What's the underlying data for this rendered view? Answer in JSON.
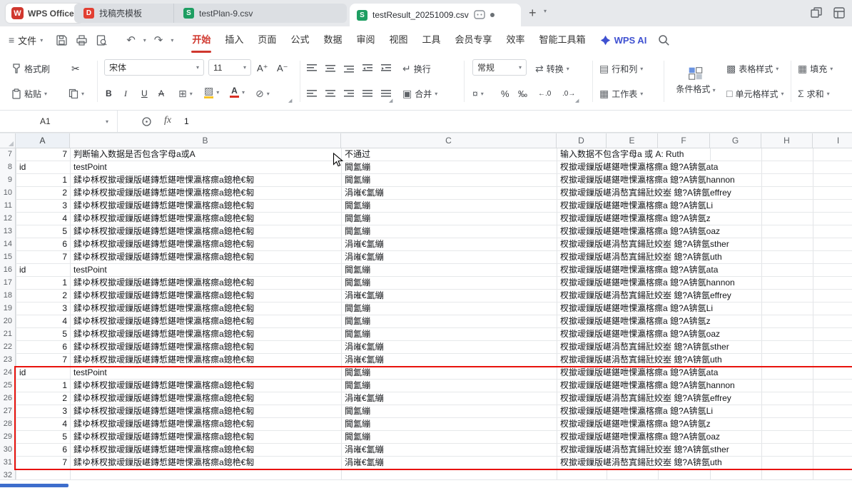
{
  "tab_bar": {
    "app_button": "WPS Office",
    "tabs": [
      {
        "label": "找稿壳模板",
        "type": "docer"
      },
      {
        "label": "testPlan-9.csv",
        "type": "sheet"
      },
      {
        "label": "testResult_20251009.csv",
        "type": "sheet",
        "active": true
      }
    ],
    "unsaved_dot": "●",
    "new_tab": "+"
  },
  "menu_bar": {
    "file_label": "文件",
    "menus": [
      {
        "label": "开始",
        "active": true
      },
      {
        "label": "插入"
      },
      {
        "label": "页面"
      },
      {
        "label": "公式"
      },
      {
        "label": "数据"
      },
      {
        "label": "审阅"
      },
      {
        "label": "视图"
      },
      {
        "label": "工具"
      },
      {
        "label": "会员专享"
      },
      {
        "label": "效率"
      },
      {
        "label": "智能工具箱"
      }
    ],
    "wps_ai": "WPS AI"
  },
  "toolbar": {
    "format_painter": "格式刷",
    "paste": "粘贴",
    "font_name": "宋体",
    "font_size": "11",
    "wrap": "换行",
    "merge": "合并",
    "number_format": "常规",
    "convert": "转换",
    "rows_cols": "行和列",
    "worksheet": "工作表",
    "conditional_format": "条件格式",
    "table_style": "表格样式",
    "cell_style": "单元格样式",
    "fill": "填充",
    "sum": "求和"
  },
  "formula_bar": {
    "name_box": "A1",
    "fx_label": "fx",
    "value": "1"
  },
  "icons": {
    "caret": "▾",
    "menu": "≡",
    "plus": "+",
    "scissors": "✂",
    "undo": "↶",
    "redo": "↷",
    "bold": "B",
    "italic": "I",
    "underline": "U",
    "strike": "A",
    "borders": "⊞",
    "fill_color": "▨",
    "font_color": "A",
    "clear": "⊘",
    "wrap": "↵",
    "merge": "▣",
    "convert": "⇄",
    "currency": "¤",
    "percent": "%",
    "permille": "‰",
    "dec_inc": "←.0",
    "dec_dec": ".0→",
    "rows_cols": "▤",
    "worksheet": "▦",
    "table_style": "▩",
    "cell_style": "□",
    "fill": "▦",
    "sum": "Σ",
    "font_bigger": "A⁺",
    "font_smaller": "A⁻",
    "launcher": "◢"
  },
  "grid": {
    "columns": [
      "A",
      "B",
      "C",
      "D",
      "E",
      "F",
      "G",
      "H",
      "I"
    ],
    "rows": [
      {
        "n": "7",
        "a": "7",
        "b": "判断输入数据是否包含字母a或A",
        "c": "不通过",
        "d": "输入数据不包含字母a 或 A: Ruth"
      },
      {
        "n": "8",
        "a": "id",
        "b": "testPoint",
        "c": "閫氳繃",
        "d": "杈撳叆鏁版嵁鍖呭惈瀛楁瘝a 鎴?A锛氬ata"
      },
      {
        "n": "9",
        "a": "1",
        "b": "鍒ゆ柇杈撳叆鏁版嵁鏄惁鍖呭惈瀛楁瘝a鎴栬€匑",
        "c": "閫氳繃",
        "d": "杈撳叆鏁版嵁鍖呭惈瀛楁瘝a 鎴?A锛氬hannon"
      },
      {
        "n": "10",
        "a": "2",
        "b": "鍒ゆ柇杈撳叆鏁版嵁鏄惁鍖呭惈瀛楁瘝a鎴栬€匑",
        "c": "涓嶉€氳繃",
        "d": "杈撳叆鏁版嵁涓嶅寘鍚瓧姣峚 鎴?A锛氬effrey"
      },
      {
        "n": "11",
        "a": "3",
        "b": "鍒ゆ柇杈撳叆鏁版嵁鏄惁鍖呭惈瀛楁瘝a鎴栬€匑",
        "c": "閫氳繃",
        "d": "杈撳叆鏁版嵁鍖呭惈瀛楁瘝a 鎴?A锛氬Li"
      },
      {
        "n": "12",
        "a": "4",
        "b": "鍒ゆ柇杈撳叆鏁版嵁鏄惁鍖呭惈瀛楁瘝a鎴栬€匑",
        "c": "閫氳繃",
        "d": "杈撳叆鏁版嵁鍖呭惈瀛楁瘝a 鎴?A锛氬z"
      },
      {
        "n": "13",
        "a": "5",
        "b": "鍒ゆ柇杈撳叆鏁版嵁鏄惁鍖呭惈瀛楁瘝a鎴栬€匑",
        "c": "閫氳繃",
        "d": "杈撳叆鏁版嵁鍖呭惈瀛楁瘝a 鎴?A锛氬oaz"
      },
      {
        "n": "14",
        "a": "6",
        "b": "鍒ゆ柇杈撳叆鏁版嵁鏄惁鍖呭惈瀛楁瘝a鎴栬€匑",
        "c": "涓嶉€氳繃",
        "d": "杈撳叆鏁版嵁涓嶅寘鍚瓧姣峚 鎴?A锛氬sther"
      },
      {
        "n": "15",
        "a": "7",
        "b": "鍒ゆ柇杈撳叆鏁版嵁鏄惁鍖呭惈瀛楁瘝a鎴栬€匑",
        "c": "涓嶉€氳繃",
        "d": "杈撳叆鏁版嵁涓嶅寘鍚瓧姣峚 鎴?A锛氬uth"
      },
      {
        "n": "16",
        "a": "id",
        "b": "testPoint",
        "c": "閫氳繃",
        "d": "杈撳叆鏁版嵁鍖呭惈瀛楁瘝a 鎴?A锛氬ata"
      },
      {
        "n": "17",
        "a": "1",
        "b": "鍒ゆ柇杈撳叆鏁版嵁鏄惁鍖呭惈瀛楁瘝a鎴栬€匑",
        "c": "閫氳繃",
        "d": "杈撳叆鏁版嵁鍖呭惈瀛楁瘝a 鎴?A锛氬hannon"
      },
      {
        "n": "18",
        "a": "2",
        "b": "鍒ゆ柇杈撳叆鏁版嵁鏄惁鍖呭惈瀛楁瘝a鎴栬€匑",
        "c": "涓嶉€氳繃",
        "d": "杈撳叆鏁版嵁涓嶅寘鍚瓧姣峚 鎴?A锛氬effrey"
      },
      {
        "n": "19",
        "a": "3",
        "b": "鍒ゆ柇杈撳叆鏁版嵁鏄惁鍖呭惈瀛楁瘝a鎴栬€匑",
        "c": "閫氳繃",
        "d": "杈撳叆鏁版嵁鍖呭惈瀛楁瘝a 鎴?A锛氬Li"
      },
      {
        "n": "20",
        "a": "4",
        "b": "鍒ゆ柇杈撳叆鏁版嵁鏄惁鍖呭惈瀛楁瘝a鎴栬€匑",
        "c": "閫氳繃",
        "d": "杈撳叆鏁版嵁鍖呭惈瀛楁瘝a 鎴?A锛氬z"
      },
      {
        "n": "21",
        "a": "5",
        "b": "鍒ゆ柇杈撳叆鏁版嵁鏄惁鍖呭惈瀛楁瘝a鎴栬€匑",
        "c": "閫氳繃",
        "d": "杈撳叆鏁版嵁鍖呭惈瀛楁瘝a 鎴?A锛氬oaz"
      },
      {
        "n": "22",
        "a": "6",
        "b": "鍒ゆ柇杈撳叆鏁版嵁鏄惁鍖呭惈瀛楁瘝a鎴栬€匑",
        "c": "涓嶉€氳繃",
        "d": "杈撳叆鏁版嵁涓嶅寘鍚瓧姣峚 鎴?A锛氬sther"
      },
      {
        "n": "23",
        "a": "7",
        "b": "鍒ゆ柇杈撳叆鏁版嵁鏄惁鍖呭惈瀛楁瘝a鎴栬€匑",
        "c": "涓嶉€氳繃",
        "d": "杈撳叆鏁版嵁涓嶅寘鍚瓧姣峚 鎴?A锛氬uth"
      },
      {
        "n": "24",
        "a": "id",
        "b": "testPoint",
        "c": "閫氳繃",
        "d": "杈撳叆鏁版嵁鍖呭惈瀛楁瘝a 鎴?A锛氬ata"
      },
      {
        "n": "25",
        "a": "1",
        "b": "鍒ゆ柇杈撳叆鏁版嵁鏄惁鍖呭惈瀛楁瘝a鎴栬€匑",
        "c": "閫氳繃",
        "d": "杈撳叆鏁版嵁鍖呭惈瀛楁瘝a 鎴?A锛氬hannon"
      },
      {
        "n": "26",
        "a": "2",
        "b": "鍒ゆ柇杈撳叆鏁版嵁鏄惁鍖呭惈瀛楁瘝a鎴栬€匑",
        "c": "涓嶉€氳繃",
        "d": "杈撳叆鏁版嵁涓嶅寘鍚瓧姣峚 鎴?A锛氬effrey"
      },
      {
        "n": "27",
        "a": "3",
        "b": "鍒ゆ柇杈撳叆鏁版嵁鏄惁鍖呭惈瀛楁瘝a鎴栬€匑",
        "c": "閫氳繃",
        "d": "杈撳叆鏁版嵁鍖呭惈瀛楁瘝a 鎴?A锛氬Li"
      },
      {
        "n": "28",
        "a": "4",
        "b": "鍒ゆ柇杈撳叆鏁版嵁鏄惁鍖呭惈瀛楁瘝a鎴栬€匑",
        "c": "閫氳繃",
        "d": "杈撳叆鏁版嵁鍖呭惈瀛楁瘝a 鎴?A锛氬z"
      },
      {
        "n": "29",
        "a": "5",
        "b": "鍒ゆ柇杈撳叆鏁版嵁鏄惁鍖呭惈瀛楁瘝a鎴栬€匑",
        "c": "閫氳繃",
        "d": "杈撳叆鏁版嵁鍖呭惈瀛楁瘝a 鎴?A锛氬oaz"
      },
      {
        "n": "30",
        "a": "6",
        "b": "鍒ゆ柇杈撳叆鏁版嵁鏄惁鍖呭惈瀛楁瘝a鎴栬€匑",
        "c": "涓嶉€氳繃",
        "d": "杈撳叆鏁版嵁涓嶅寘鍚瓧姣峚 鎴?A锛氬sther"
      },
      {
        "n": "31",
        "a": "7",
        "b": "鍒ゆ柇杈撳叆鏁版嵁鏄惁鍖呭惈瀛楁瘝a鎴栬€匑",
        "c": "涓嶉€氳繃",
        "d": "杈撳叆鏁版嵁涓嶅寘鍚瓧姣峚 鎴?A锛氬uth"
      },
      {
        "n": "32",
        "a": "",
        "b": "",
        "c": "",
        "d": ""
      }
    ]
  },
  "annotations": {
    "highlighted_rows": "24-31"
  },
  "colors": {
    "accent_red": "#d0372e",
    "selection_red": "#e8120c",
    "sheet_green": "#1e9e62",
    "docer_red": "#e23f32",
    "bottom_blue": "#3d6dcc"
  }
}
